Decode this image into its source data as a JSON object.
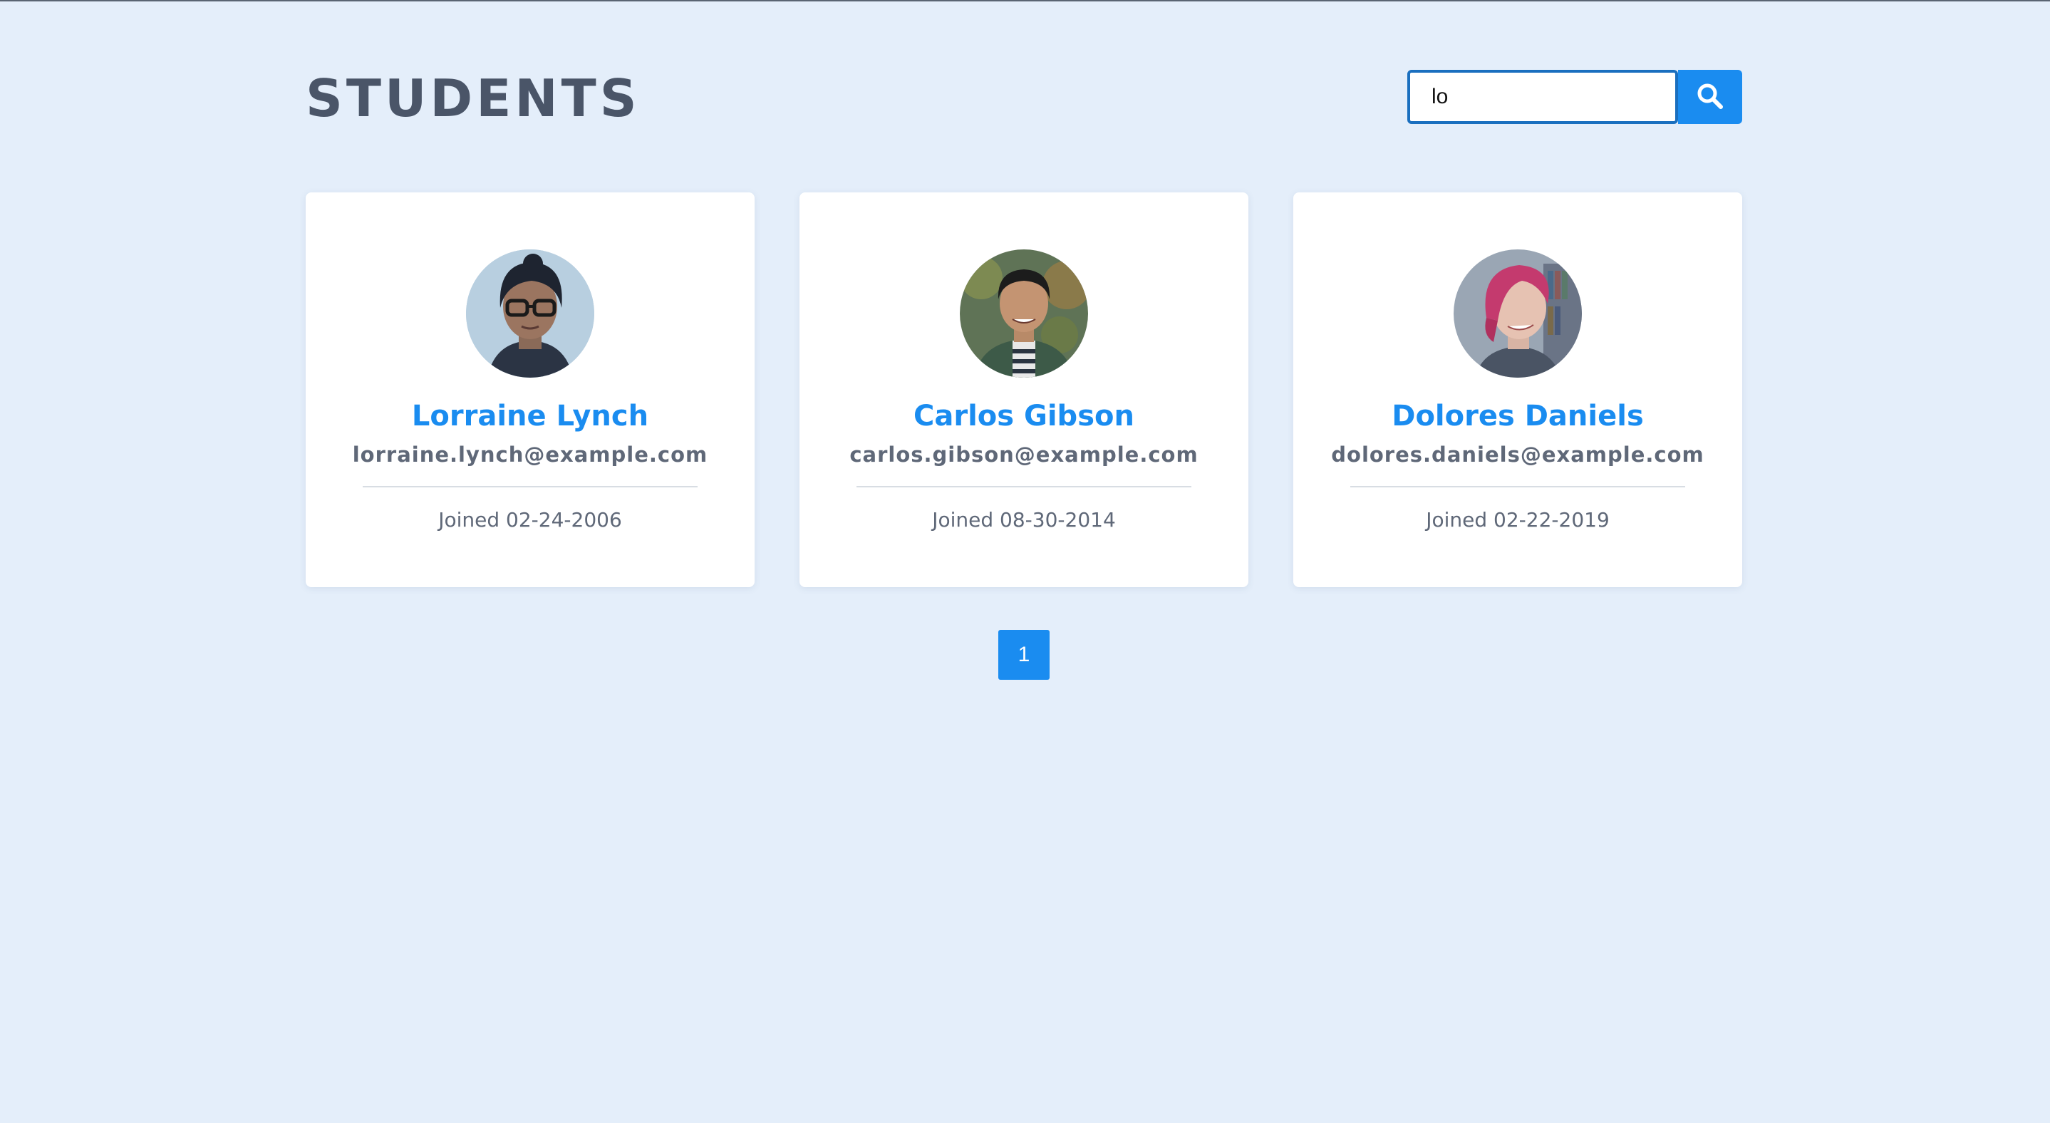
{
  "header": {
    "title": "STUDENTS"
  },
  "search": {
    "value": "lo",
    "button_icon": "search-icon"
  },
  "students": [
    {
      "name": "Lorraine Lynch",
      "email": "lorraine.lynch@example.com",
      "joined": "Joined 02-24-2006"
    },
    {
      "name": "Carlos Gibson",
      "email": "carlos.gibson@example.com",
      "joined": "Joined 08-30-2014"
    },
    {
      "name": "Dolores Daniels",
      "email": "dolores.daniels@example.com",
      "joined": "Joined 02-22-2019"
    }
  ],
  "pagination": {
    "pages": [
      "1"
    ],
    "current": "1"
  },
  "colors": {
    "background": "#e4eefa",
    "accent": "#1a8cf0",
    "title": "#4a5568",
    "muted_text": "#5f6878"
  }
}
